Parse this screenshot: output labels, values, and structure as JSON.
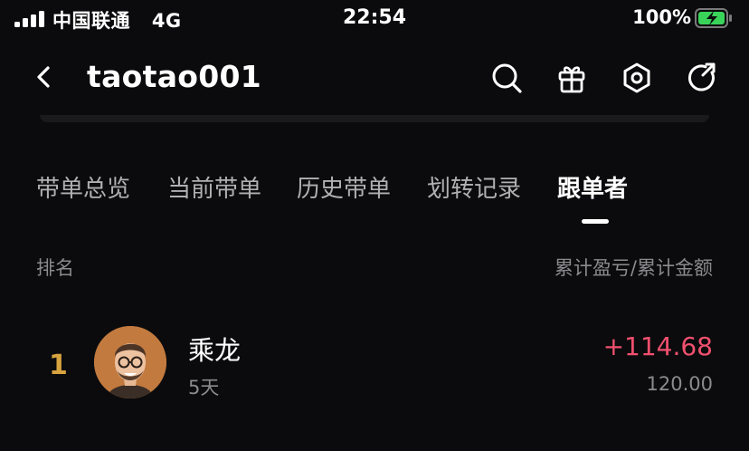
{
  "status_bar": {
    "carrier": "中国联通",
    "network": "4G",
    "time": "22:54",
    "battery_percent": "100%",
    "battery_color": "#39d35a",
    "signal_icon": "signal-bars-icon",
    "battery_icon": "battery-charging-icon"
  },
  "nav": {
    "back_icon": "chevron-left-icon",
    "title": "taotao001",
    "icons": [
      "search-icon",
      "gift-icon",
      "settings-icon",
      "share-icon"
    ]
  },
  "tabs": [
    {
      "label": "带单总览",
      "active": false
    },
    {
      "label": "当前带单",
      "active": false
    },
    {
      "label": "历史带单",
      "active": false
    },
    {
      "label": "划转记录",
      "active": false
    },
    {
      "label": "跟单者",
      "active": true
    }
  ],
  "list_header": {
    "left": "排名",
    "right": "累计盈亏/累计金额"
  },
  "followers": [
    {
      "rank": "1",
      "name": "乘龙",
      "days": "5天",
      "pnl": "+114.68",
      "amount": "120.00",
      "pnl_color": "#f0506e"
    }
  ]
}
